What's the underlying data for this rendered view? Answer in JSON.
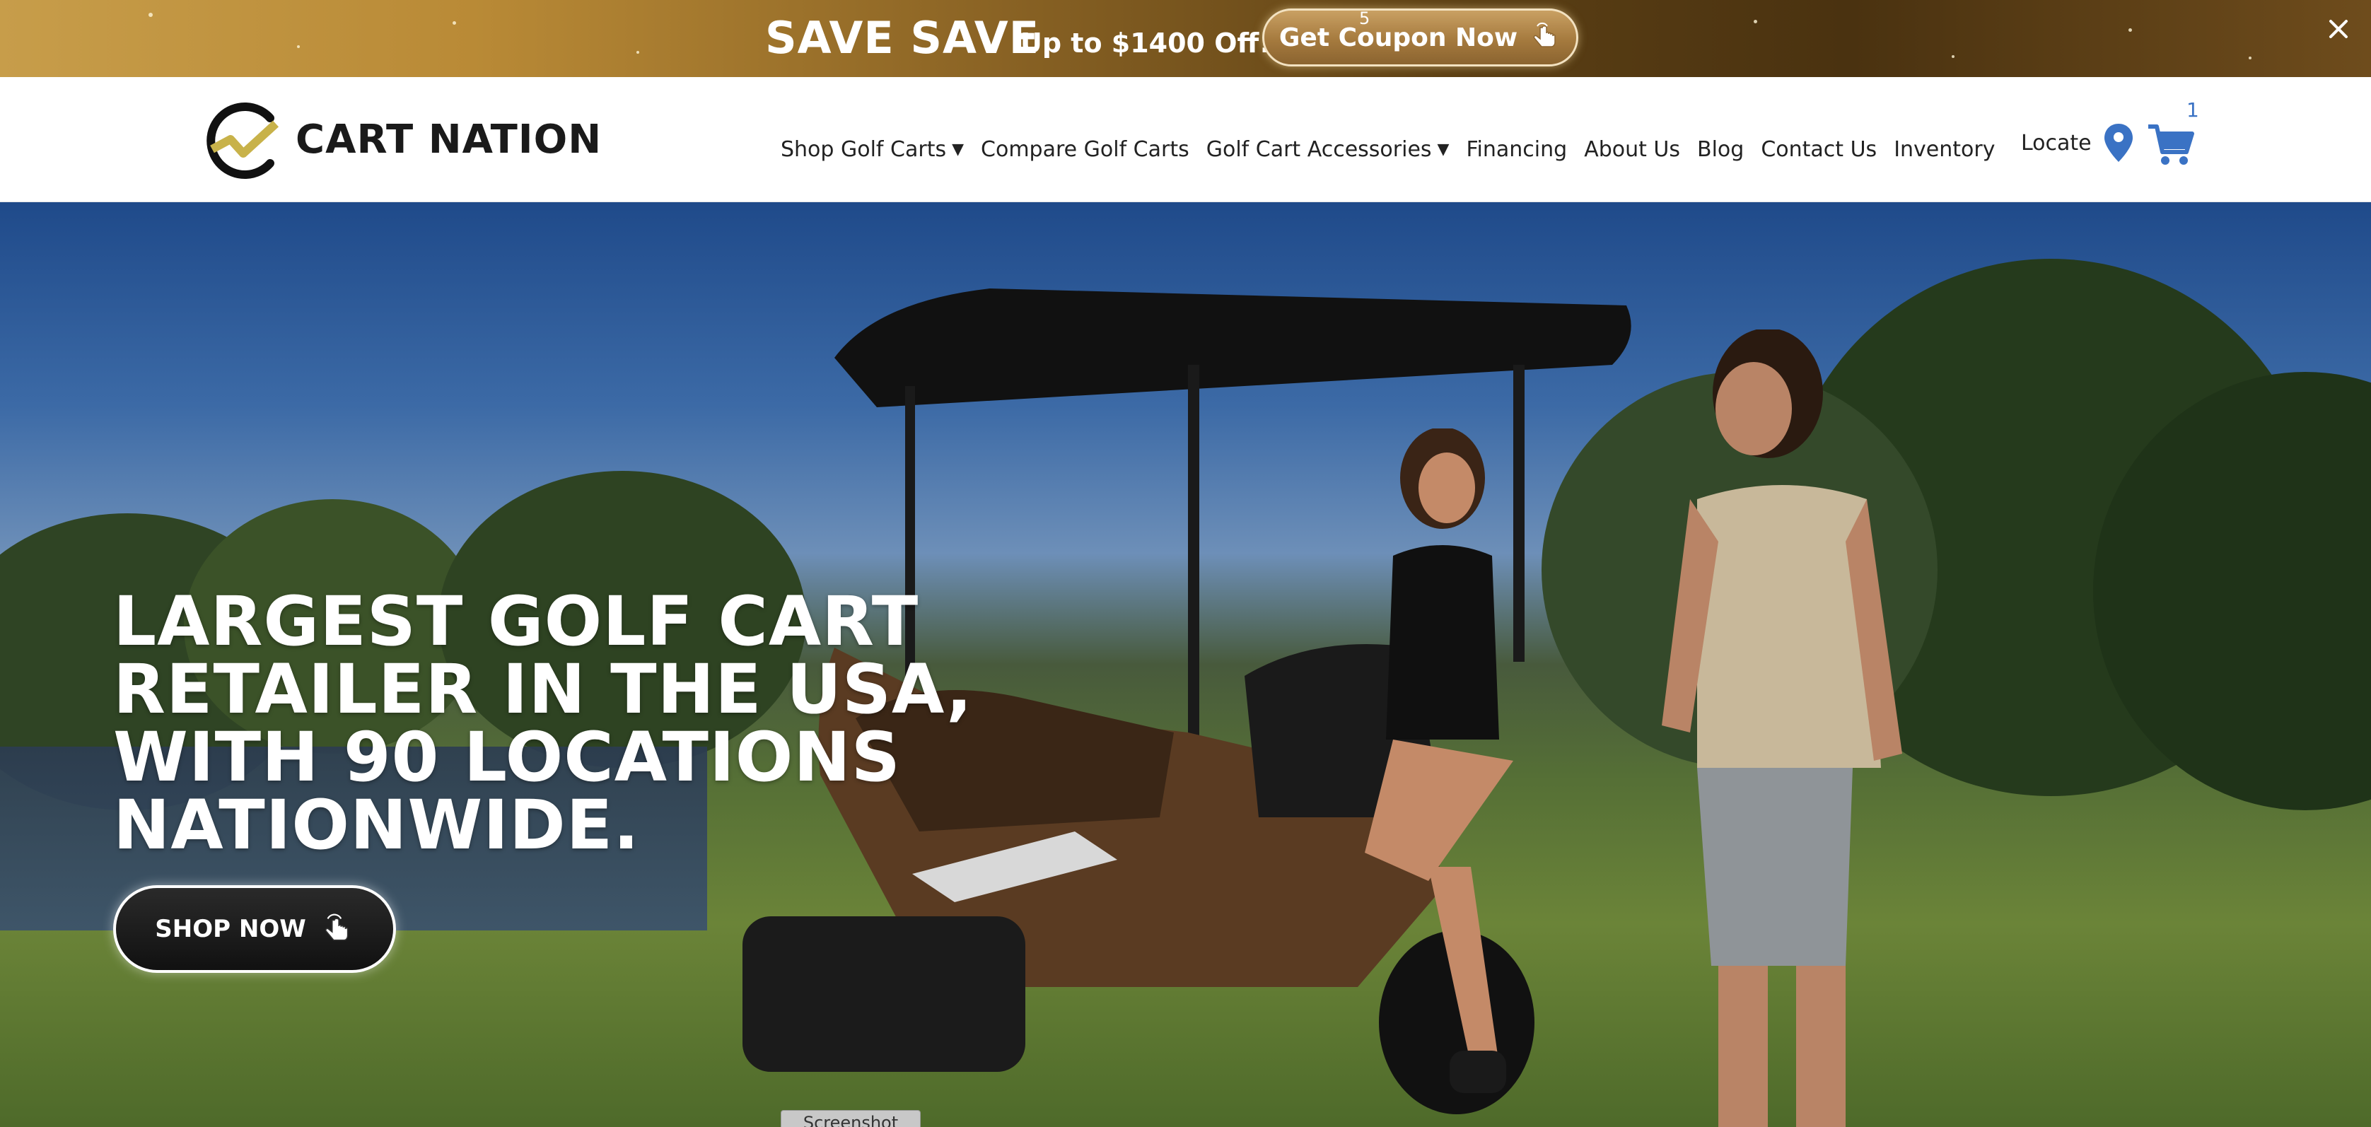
{
  "promo": {
    "headline": "SAVE SAVE",
    "subhead": "Up to $1400 Off!",
    "coupon_label": "Get Coupon Now",
    "counter": "5",
    "close_icon": "close-icon"
  },
  "header": {
    "logo_text": "CART NATION",
    "nav": [
      {
        "label": "Shop Golf Carts",
        "dropdown": true
      },
      {
        "label": "Compare Golf Carts",
        "dropdown": false
      },
      {
        "label": "Golf Cart Accessories",
        "dropdown": true
      },
      {
        "label": "Financing",
        "dropdown": false
      },
      {
        "label": "About Us",
        "dropdown": false
      },
      {
        "label": "Blog",
        "dropdown": false
      },
      {
        "label": "Contact Us",
        "dropdown": false
      },
      {
        "label": "Inventory",
        "dropdown": false
      }
    ],
    "locate_label": "Locate",
    "cart_count": "1"
  },
  "hero": {
    "title": "LARGEST GOLF CART RETAILER IN THE USA, WITH 90 LOCATIONS NATIONWIDE.",
    "cta_label": "SHOP NOW"
  },
  "overlay": {
    "screenshot_label": "Screenshot"
  },
  "colors": {
    "accent_blue": "#3a72c4",
    "promo_gold": "#c79d4a",
    "promo_dark": "#4a3210",
    "logo_gold": "#c8b24a"
  }
}
